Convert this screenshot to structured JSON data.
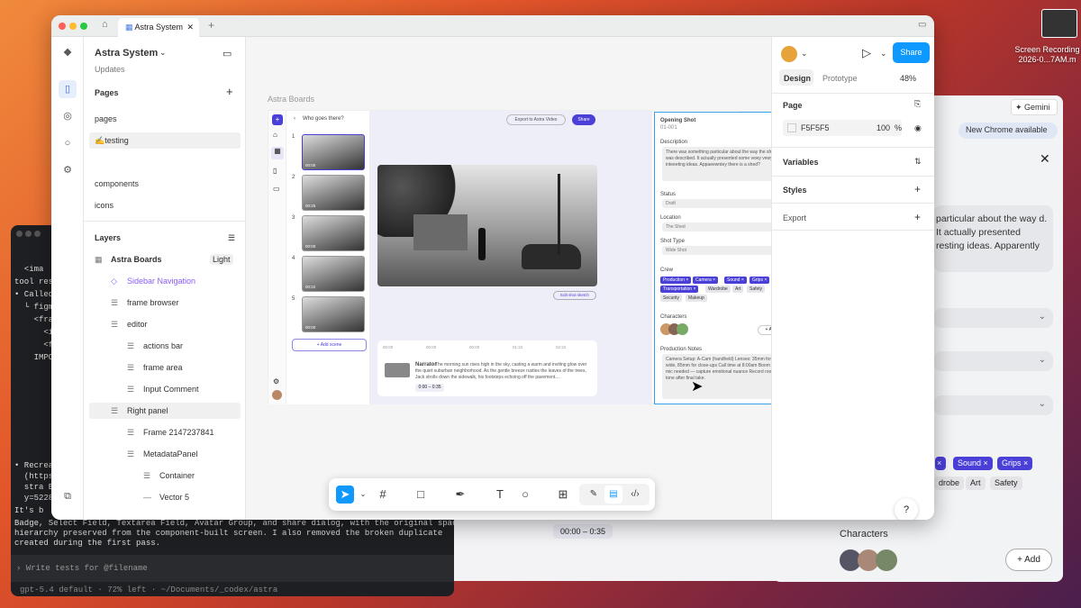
{
  "desktop": {
    "recording_label": "Screen Recording 2026-0...7AM.m"
  },
  "terminal": {
    "lines": [
      "  <ima",
      "tool res",
      "• Called",
      "  └ figm",
      "    <fra",
      "      <i",
      "      <f",
      "    IMPO",
      "• Recrea",
      "  (https",
      "  stra B",
      "  y=5228",
      "It's b",
      "Badge, Select Field, Textarea Field, Avatar Group, and share dialog, with the original spacing",
      "hierarchy preserved from the component-built screen. I also removed the broken duplicate",
      "created during the first pass."
    ],
    "prompt": "› Write tests for @filename",
    "status": "gpt-5.4 default · 72% left · ~/Documents/_codex/astra"
  },
  "chrome": {
    "gemini": "Gemini",
    "new_chrome": "New Chrome available",
    "text": "particular about the way d. It actually presented resting ideas. Apparently",
    "chips": [
      "drobe",
      "Art",
      "Safety"
    ],
    "tags": [
      "Sound",
      "Grips"
    ],
    "characters": "Characters",
    "add": "+ Add",
    "time": "00:00 – 0:35"
  },
  "figma": {
    "tab": "Astra System",
    "file_title": "Astra System",
    "file_sub": "Updates",
    "pages_label": "Pages",
    "pages": [
      "pages",
      "testing",
      "components",
      "icons"
    ],
    "layers_label": "Layers",
    "layers": [
      {
        "name": "Astra Boards",
        "badge": "Light"
      },
      {
        "name": "Sidebar Navigation"
      },
      {
        "name": "frame browser"
      },
      {
        "name": "editor"
      },
      {
        "name": "actions bar"
      },
      {
        "name": "frame area"
      },
      {
        "name": "Input Comment"
      },
      {
        "name": "Right panel"
      },
      {
        "name": "Frame 2147237841"
      },
      {
        "name": "MetadataPanel"
      },
      {
        "name": "Container"
      },
      {
        "name": "Vector 5"
      }
    ],
    "canvas_label": "Astra Boards",
    "frame": {
      "back": "Who goes there?",
      "export": "Export to Astra Video",
      "share": "Share",
      "add_scene": "+ Add scene",
      "edit_sketch": "Edit shot sketch",
      "narrator": "Narrator",
      "narration": "The morning sun rises high in the sky, casting a warm and inviting glow over the quiet suburban neighborhood. As the gentle breeze rustles the leaves of the trees, Jack strolls down the sidewalk, his footsteps echoing off the pavement....",
      "narration_time": "0:00 – 0:35",
      "timeline": [
        "00:00",
        "00:00",
        "00:00",
        "01:22",
        "02:22"
      ],
      "thumb_times": [
        "00:00",
        "00:25",
        "00:00",
        "00:22",
        "00:00"
      ],
      "meta": {
        "title": "Opening Shot",
        "id": "01-001",
        "desc_label": "Description",
        "desc": "There was something particular about the way the shot was described. It actually presented some vewy vewy inteeeting ideas. Appaeewntey there is a shed?",
        "status_label": "Status",
        "status": "Draft",
        "location_label": "Location",
        "location": "The Shed",
        "shot_label": "Shot Type",
        "shot": "Wide Shot",
        "crew_label": "Crew",
        "crew_blue": [
          "Production",
          "Camera",
          "Sound",
          "Grips",
          "Transportation"
        ],
        "crew_gray": [
          "Wardrobe",
          "Art",
          "Safety",
          "Security",
          "Makeup"
        ],
        "chars_label": "Characters",
        "chars_add": "+ Add",
        "notes_label": "Production Notes",
        "notes": "Camera Setup: A-Cam (handheld) Lenses: 35mm for wide, 85mm for close-ups Call time at 8:00am Boom and mic needed — capture emotional nuance Record room tone after final take."
      }
    },
    "right": {
      "design": "Design",
      "prototype": "Prototype",
      "zoom": "48%",
      "share": "Share",
      "page_label": "Page",
      "bg": "F5F5F5",
      "opacity": "100",
      "pct": "%",
      "variables": "Variables",
      "styles": "Styles",
      "export": "Export"
    },
    "help": "?"
  }
}
